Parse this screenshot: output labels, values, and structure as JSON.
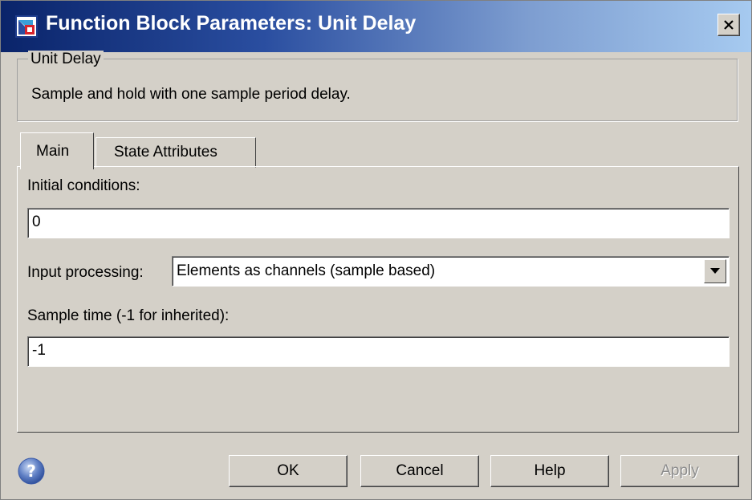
{
  "window": {
    "title": "Function Block Parameters: Unit Delay",
    "close_icon": "close-icon"
  },
  "block": {
    "group_label": "Unit Delay",
    "description": "Sample and hold with one sample period delay."
  },
  "tabs": [
    {
      "label": "Main",
      "active": true
    },
    {
      "label": "State Attributes",
      "active": false
    }
  ],
  "main": {
    "initial_conditions_label": "Initial conditions:",
    "initial_conditions_value": "0",
    "input_processing_label": "Input processing:",
    "input_processing_value": "Elements as channels (sample based)",
    "sample_time_label": "Sample time (-1 for inherited):",
    "sample_time_value": "-1"
  },
  "buttons": {
    "ok": "OK",
    "cancel": "Cancel",
    "help": "Help",
    "apply": "Apply"
  },
  "icons": {
    "app": "simulink-block-icon",
    "help": "help-question-icon",
    "dropdown": "dropdown-arrow-icon"
  },
  "colors": {
    "titlebar_start": "#0a246a",
    "titlebar_end": "#a6caf0",
    "dialog_bg": "#d4d0c8",
    "disabled_text": "#8d8d8d"
  }
}
